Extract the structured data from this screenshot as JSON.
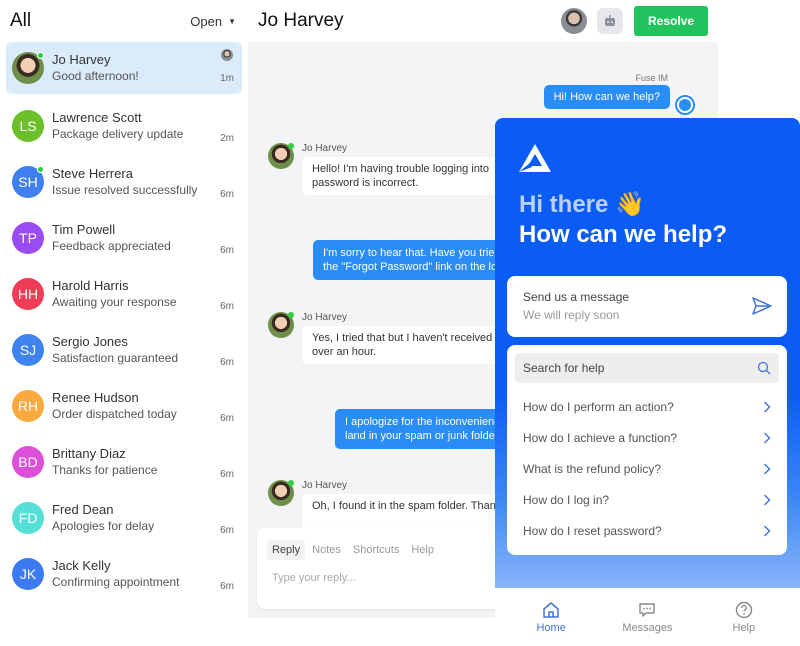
{
  "sidebar": {
    "title": "All",
    "filter": "Open",
    "conversations": [
      {
        "initials": "",
        "name": "Jo Harvey",
        "preview": "Good afternoon!",
        "time": "1m",
        "online": true,
        "photo": true,
        "active": true,
        "color": "#4a8f3a"
      },
      {
        "initials": "LS",
        "name": "Lawrence Scott",
        "preview": "Package delivery update",
        "time": "2m",
        "online": false,
        "color": "#6bbf2a"
      },
      {
        "initials": "SH",
        "name": "Steve Herrera",
        "preview": "Issue resolved successfully",
        "time": "6m",
        "online": true,
        "color": "#3f7ff0"
      },
      {
        "initials": "TP",
        "name": "Tim Powell",
        "preview": "Feedback appreciated",
        "time": "6m",
        "online": false,
        "color": "#9b4cf0"
      },
      {
        "initials": "HH",
        "name": "Harold Harris",
        "preview": "Awaiting your response",
        "time": "6m",
        "online": false,
        "color": "#ee3d54"
      },
      {
        "initials": "SJ",
        "name": "Sergio Jones",
        "preview": "Satisfaction guaranteed",
        "time": "6m",
        "online": false,
        "color": "#3f83ee"
      },
      {
        "initials": "RH",
        "name": "Renee Hudson",
        "preview": "Order dispatched today",
        "time": "6m",
        "online": false,
        "color": "#f9a93f"
      },
      {
        "initials": "BD",
        "name": "Brittany Diaz",
        "preview": "Thanks for patience",
        "time": "6m",
        "online": false,
        "color": "#dd4fd8"
      },
      {
        "initials": "FD",
        "name": "Fred Dean",
        "preview": "Apologies for delay",
        "time": "6m",
        "online": false,
        "color": "#56dfd6"
      },
      {
        "initials": "JK",
        "name": "Jack Kelly",
        "preview": "Confirming appointment",
        "time": "6m",
        "online": false,
        "color": "#3c7af2"
      }
    ]
  },
  "chat": {
    "title": "Jo Harvey",
    "resolve_label": "Resolve",
    "bot_name": "Fuse IM",
    "bot_message": "Hi! How can we help?",
    "messages": [
      {
        "direction": "in",
        "sender": "Jo Harvey",
        "lines": [
          "Hello! I'm having trouble logging into",
          "password is incorrect."
        ]
      },
      {
        "direction": "out",
        "lines": [
          "I'm sorry to hear that. Have you tried",
          "the \"Forgot Password\" link on the lo"
        ]
      },
      {
        "direction": "in",
        "sender": "Jo Harvey",
        "lines": [
          "Yes, I tried that but I haven't received",
          "over an hour."
        ]
      },
      {
        "direction": "out",
        "lines": [
          "I apologize for the inconvenience",
          "land in your spam or junk folder"
        ]
      },
      {
        "direction": "in",
        "sender": "Jo Harvey",
        "lines": [
          "Oh, I found it in the spam folder. Thanks",
          ""
        ]
      }
    ],
    "composer": {
      "tabs": [
        "Reply",
        "Notes",
        "Shortcuts",
        "Help"
      ],
      "active_tab": "Reply",
      "placeholder": "Type your reply..."
    }
  },
  "widget": {
    "greeting_line1": "Hi there 👋",
    "greeting_line2": "How can we help?",
    "send_title": "Send us a message",
    "send_subtitle": "We will reply soon",
    "search_placeholder": "Search for help",
    "faqs": [
      "How do I perform an action?",
      "How do I achieve a function?",
      "What is the refund policy?",
      "How do I log in?",
      "How do I reset password?"
    ],
    "nav": [
      {
        "label": "Home",
        "icon": "home-icon",
        "active": true
      },
      {
        "label": "Messages",
        "icon": "chat-bubble-icon",
        "active": false
      },
      {
        "label": "Help",
        "icon": "help-circle-icon",
        "active": false
      }
    ],
    "brand_color": "#0b5cf5"
  }
}
